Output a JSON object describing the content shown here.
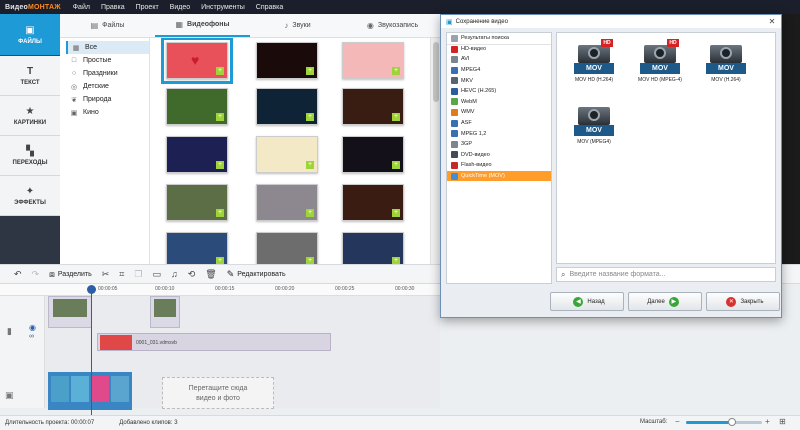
{
  "app": {
    "brand_prefix": "Видео",
    "brand_suffix": "МОНТАЖ"
  },
  "menu": [
    "Файл",
    "Правка",
    "Проект",
    "Видео",
    "Инструменты",
    "Справка"
  ],
  "leftnav": [
    {
      "label": "ФАЙЛЫ",
      "icon": "folder-icon",
      "active": true
    },
    {
      "label": "ТЕКСТ",
      "icon": "text-icon",
      "active": false
    },
    {
      "label": "КАРТИНКИ",
      "icon": "star-icon",
      "active": false
    },
    {
      "label": "ПЕРЕХОДЫ",
      "icon": "transitions-icon",
      "active": false
    },
    {
      "label": "ЭФФЕКТЫ",
      "icon": "effects-icon",
      "active": false
    }
  ],
  "tabs": [
    {
      "label": "Файлы",
      "icon": "files-icon",
      "active": false
    },
    {
      "label": "Видеофоны",
      "icon": "film-icon",
      "active": true
    },
    {
      "label": "Звуки",
      "icon": "music-icon",
      "active": false
    },
    {
      "label": "Звукозапись",
      "icon": "mic-icon",
      "active": false
    }
  ],
  "categories": [
    {
      "label": "Все",
      "icon": "grid-icon",
      "active": true
    },
    {
      "label": "Простые",
      "icon": "square-icon",
      "active": false
    },
    {
      "label": "Праздники",
      "icon": "balloon-icon",
      "active": false
    },
    {
      "label": "Детские",
      "icon": "bear-icon",
      "active": false
    },
    {
      "label": "Природа",
      "icon": "leaf-icon",
      "active": false
    },
    {
      "label": "Кино",
      "icon": "camera-icon",
      "active": false
    }
  ],
  "backgrounds": [
    {
      "color": "#e8505a",
      "selected": true
    },
    {
      "color": "#1b0a0a",
      "selected": false
    },
    {
      "color": "#f4b8b8",
      "selected": false
    },
    {
      "color": "#3f6a2c",
      "selected": false
    },
    {
      "color": "#0e2436",
      "selected": false
    },
    {
      "color": "#3a1d12",
      "selected": false
    },
    {
      "color": "#1c2052",
      "selected": false
    },
    {
      "color": "#f3e9c6",
      "selected": false
    },
    {
      "color": "#14101a",
      "selected": false
    },
    {
      "color": "#5c6e46",
      "selected": false
    },
    {
      "color": "#8d8790",
      "selected": false
    },
    {
      "color": "#3a1c12",
      "selected": false
    },
    {
      "color": "#2b4c7a",
      "selected": false
    },
    {
      "color": "#6d6d6d",
      "selected": false
    },
    {
      "color": "#24365c",
      "selected": false
    }
  ],
  "toolbar": {
    "split_label": "Разделить",
    "edit_label": "Редактировать"
  },
  "ruler": [
    "00:00:05",
    "00:00:10",
    "00:00:15",
    "00:00:20",
    "00:00:25",
    "00:00:30"
  ],
  "timeline": {
    "overlay_clip_label": "0001_031.vdmsvb",
    "drop_line1": "Перетащите сюда",
    "drop_line2": "видео и фото"
  },
  "status": {
    "duration_label": "Длительность проекта:",
    "duration_value": "00:00:07",
    "clips_label": "Добавлено клипов:",
    "clips_value": "3",
    "zoom_label": "Масштаб:",
    "zoom_level": 0.6
  },
  "dialog": {
    "title": "Сохранение видео",
    "formats": [
      {
        "label": "Результаты поиска",
        "color": "#9aa3ad",
        "highlight": false
      },
      {
        "label": "HD-видео",
        "color": "#d62222",
        "highlight": false
      },
      {
        "label": "AVI",
        "color": "#7a8590",
        "highlight": false
      },
      {
        "label": "MPEG4",
        "color": "#3a6fb0",
        "highlight": false
      },
      {
        "label": "MKV",
        "color": "#5a6470",
        "highlight": false
      },
      {
        "label": "HEVC (H.265)",
        "color": "#2c5f9a",
        "highlight": false
      },
      {
        "label": "WebM",
        "color": "#5aa64a",
        "highlight": false
      },
      {
        "label": "WMV",
        "color": "#e07b1a",
        "highlight": false
      },
      {
        "label": "ASF",
        "color": "#3a6fb0",
        "highlight": false
      },
      {
        "label": "MPEG 1,2",
        "color": "#3a6fb0",
        "highlight": false
      },
      {
        "label": "3GP",
        "color": "#7a8590",
        "highlight": false
      },
      {
        "label": "DVD-видео",
        "color": "#444b55",
        "highlight": false
      },
      {
        "label": "Flash-видео",
        "color": "#c62828",
        "highlight": false
      },
      {
        "label": "QuickTime (MOV)",
        "color": "#3d8fd6",
        "highlight": true
      }
    ],
    "presets": [
      {
        "name": "MOV HD (H.264)",
        "badge": "MOV",
        "hd": "HD"
      },
      {
        "name": "MOV HD (MPEG-4)",
        "badge": "MOV",
        "hd": "HD"
      },
      {
        "name": "MOV (H.264)",
        "badge": "MOV",
        "hd": ""
      },
      {
        "name": "MOV (MPEG4)",
        "badge": "MOV",
        "hd": ""
      }
    ],
    "search_placeholder": "Введите название формата...",
    "back_label": "Назад",
    "next_label": "Далее",
    "close_label": "Закрыть"
  }
}
